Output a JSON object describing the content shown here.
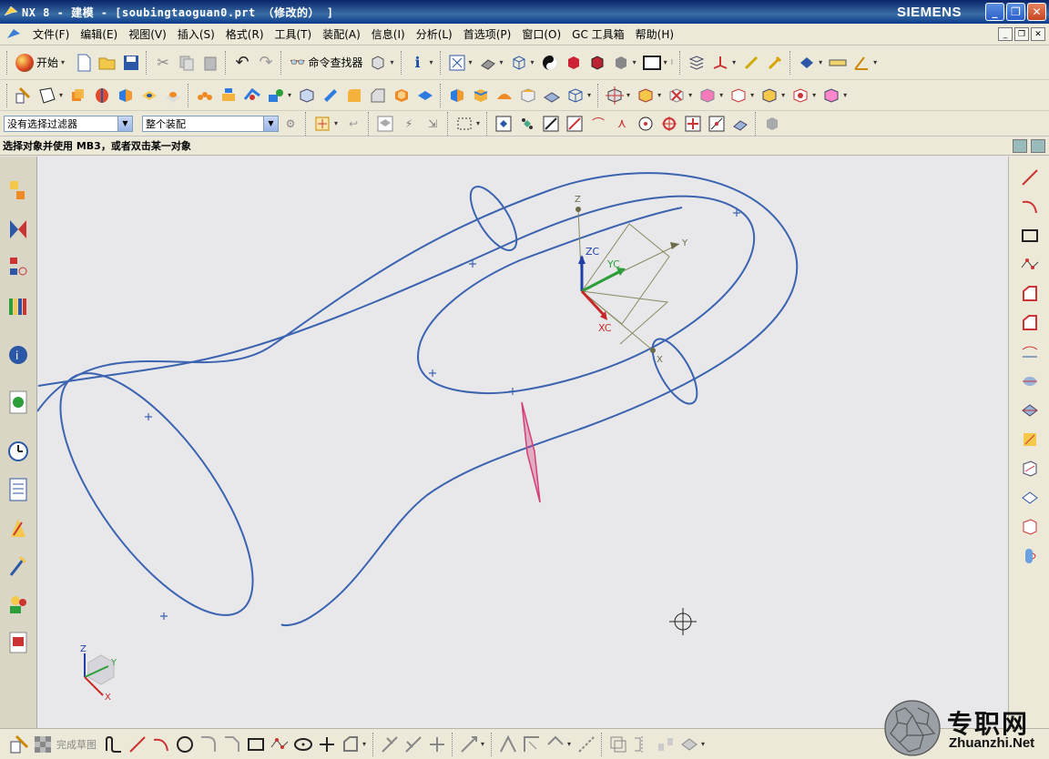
{
  "window": {
    "title": "NX 8 - 建模 - [soubingtaoguan0.prt （修改的） ]",
    "brand": "SIEMENS",
    "minimize_icon": "minimize-icon",
    "restore_icon": "restore-icon",
    "close_icon": "close-icon"
  },
  "menubar": {
    "items": [
      "文件(F)",
      "编辑(E)",
      "视图(V)",
      "插入(S)",
      "格式(R)",
      "工具(T)",
      "装配(A)",
      "信息(I)",
      "分析(L)",
      "首选项(P)",
      "窗口(O)",
      "GC 工具箱",
      "帮助(H)"
    ]
  },
  "toolbar1": {
    "start_label": "开始",
    "command_finder_label": "命令查找器"
  },
  "selection_bar": {
    "filter_value": "没有选择过滤器",
    "scope_value": "整个装配"
  },
  "cue_line": {
    "text": "选择对象并使用 MB3，或者双击某一对象"
  },
  "viewport": {
    "wcs_labels": {
      "z": "Z",
      "y": "Y",
      "x": "X",
      "zc": "ZC",
      "yc": "YC",
      "xc": "XC"
    },
    "triad_labels": {
      "z": "Z",
      "y": "Y",
      "x": "X"
    },
    "curve_color": "#3b63b0",
    "plane_color": "#d23f78"
  },
  "sketch_toolbar": {
    "finish_label": "完成草图"
  },
  "watermark": {
    "text": "专职网",
    "url": "Zhuanzhi.Net"
  }
}
